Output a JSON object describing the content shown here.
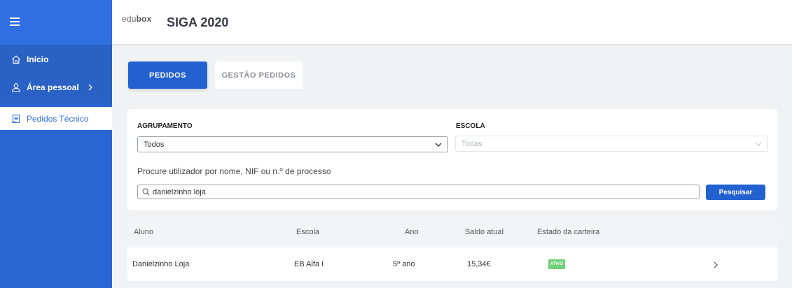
{
  "sidebar": {
    "menu_icon": "hamburger-icon",
    "items": [
      {
        "label": "Início",
        "icon": "home-icon"
      },
      {
        "label": "Área pessoal",
        "icon": "user-icon"
      },
      {
        "label": "Pedidos Técnico",
        "icon": "document-icon"
      }
    ]
  },
  "header": {
    "logo_edu": "edu",
    "logo_box": "box",
    "title": "SIGA 2020"
  },
  "tabs": [
    {
      "label": "PEDIDOS",
      "active": true
    },
    {
      "label": "GESTÃO PEDIDOS",
      "active": false
    }
  ],
  "filters": {
    "agrupamento_label": "AGRUPAMENTO",
    "agrupamento_value": "Todos",
    "escola_label": "ESCOLA",
    "escola_value": "Todas",
    "search_label": "Procure utilizador por nome, NIF ou n.º de processo",
    "search_value": "danielzinho loja",
    "search_button": "Pesquisar"
  },
  "table": {
    "columns": [
      "Aluno",
      "Escola",
      "Ano",
      "Saldo atual",
      "Estado da carteira"
    ],
    "rows": [
      {
        "aluno": "Danielzinho Loja",
        "escola": "EB Alfa I",
        "ano": "5º ano",
        "saldo": "15,34€",
        "estado": "ATIVO"
      }
    ]
  },
  "colors": {
    "primary": "#2361d0",
    "sidebar": "#2a66d1",
    "status_active": "#6fd07a"
  }
}
